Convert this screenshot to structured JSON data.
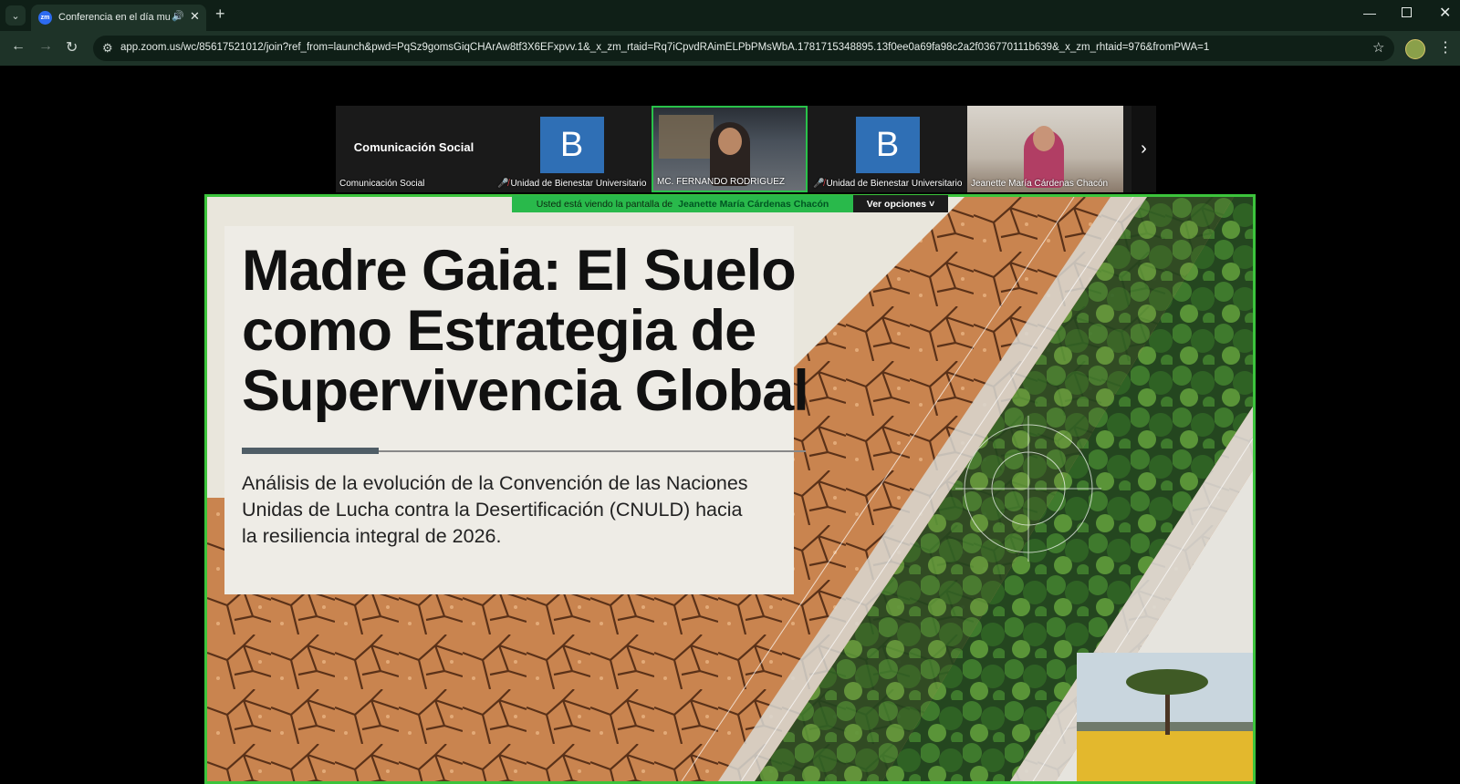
{
  "browser": {
    "tab_title": "Conferencia en el día mundial",
    "favicon_text": "zm",
    "url": "app.zoom.us/wc/85617521012/join?ref_from=launch&pwd=PqSz9gomsGiqCHArAw8tf3X6EFxpvv.1&_x_zm_rtaid=Rq7iCpvdRAimELPbPMsWbA.1781715348895.13f0ee0a69fa98c2a2f036770111b639&_x_zm_rhtaid=976&fromPWA=1"
  },
  "participants": [
    {
      "name": "Comunicación Social",
      "label": "Comunicación Social",
      "kind": "name-only",
      "muted": false
    },
    {
      "name": "Unidad de Bienestar Universitario",
      "label": "Unidad de Bienestar Universitario",
      "kind": "avatar",
      "initial": "B",
      "muted": true
    },
    {
      "name": "MC. FERNANDO RODRIGUEZ",
      "label": "MC. FERNANDO RODRIGUEZ",
      "kind": "video",
      "active": true,
      "muted": false
    },
    {
      "name": "Unidad de Bienestar Universitario",
      "label": "Unidad de Bienestar Universitario",
      "kind": "avatar",
      "initial": "B",
      "muted": true
    },
    {
      "name": "Jeanette María Cárdenas Chacón",
      "label": "Jeanette María Cárdenas Chacón",
      "kind": "video",
      "muted": false
    }
  ],
  "share_banner": {
    "text": "Usted está viendo la pantalla de",
    "presenter": "Jeanette María Cárdenas Chacón",
    "options": "Ver opciones"
  },
  "slide": {
    "title": "Madre Gaia: El Suelo como Estrategia de Supervivencia Global",
    "subtitle": "Análisis de la evolución de la Convención de las Naciones Unidas de Lucha contra la Desertificación (CNULD) hacia la resiliencia integral de 2026."
  },
  "colors": {
    "active_border": "#29c24a",
    "avatar_bg": "#2f6fb5",
    "mute": "#e0424a"
  }
}
